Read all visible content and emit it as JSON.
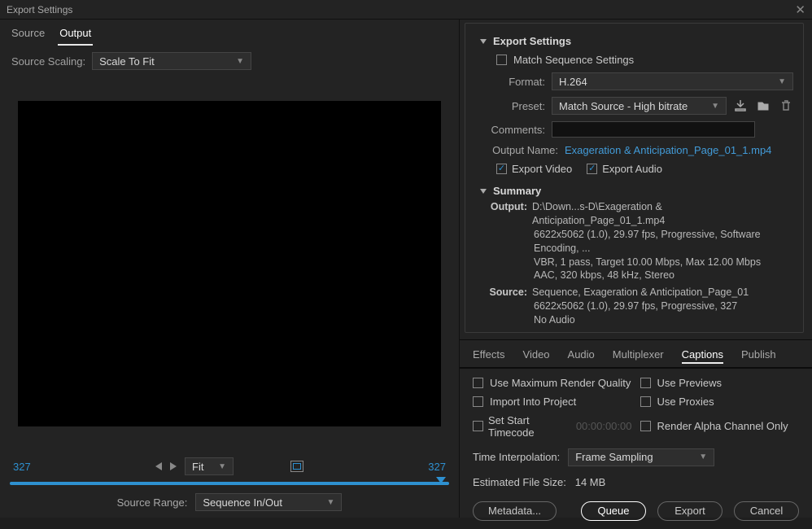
{
  "window_title": "Export Settings",
  "left_tabs": [
    "Source",
    "Output"
  ],
  "left_tabs_active": 1,
  "source_scaling": {
    "label": "Source Scaling:",
    "value": "Scale To Fit"
  },
  "timeline_in": "327",
  "timeline_out": "327",
  "fit_select": "Fit",
  "source_range": {
    "label": "Source Range:",
    "value": "Sequence In/Out"
  },
  "export_settings": {
    "title": "Export Settings",
    "match_sequence_label": "Match Sequence Settings",
    "format": {
      "label": "Format:",
      "value": "H.264"
    },
    "preset": {
      "label": "Preset:",
      "value": "Match Source - High bitrate"
    },
    "comments": {
      "label": "Comments:",
      "value": ""
    },
    "output_name": {
      "label": "Output Name:",
      "value": "Exageration & Anticipation_Page_01_1.mp4"
    },
    "export_video_label": "Export Video",
    "export_audio_label": "Export Audio"
  },
  "summary": {
    "title": "Summary",
    "output_label": "Output:",
    "output_lines": [
      "D:\\Down...s-D\\Exageration & Anticipation_Page_01_1.mp4",
      "6622x5062 (1.0), 29.97 fps, Progressive, Software Encoding, ...",
      "VBR, 1 pass, Target 10.00 Mbps, Max 12.00 Mbps",
      "AAC, 320 kbps, 48 kHz, Stereo"
    ],
    "source_label": "Source:",
    "source_lines": [
      "Sequence, Exageration & Anticipation_Page_01",
      "6622x5062 (1.0), 29.97 fps, Progressive, 327",
      "No Audio"
    ]
  },
  "right_tabs": [
    "Effects",
    "Video",
    "Audio",
    "Multiplexer",
    "Captions",
    "Publish"
  ],
  "right_tabs_active": 4,
  "options": {
    "max_quality": "Use Maximum Render Quality",
    "use_previews": "Use Previews",
    "import_project": "Import Into Project",
    "use_proxies": "Use Proxies",
    "set_start_tc": "Set Start Timecode",
    "tc_value": "00:00:00:00",
    "render_alpha": "Render Alpha Channel Only",
    "time_interp": {
      "label": "Time Interpolation:",
      "value": "Frame Sampling"
    },
    "est_size_label": "Estimated File Size:",
    "est_size_value": "14 MB"
  },
  "buttons": {
    "metadata": "Metadata...",
    "queue": "Queue",
    "export": "Export",
    "cancel": "Cancel"
  }
}
